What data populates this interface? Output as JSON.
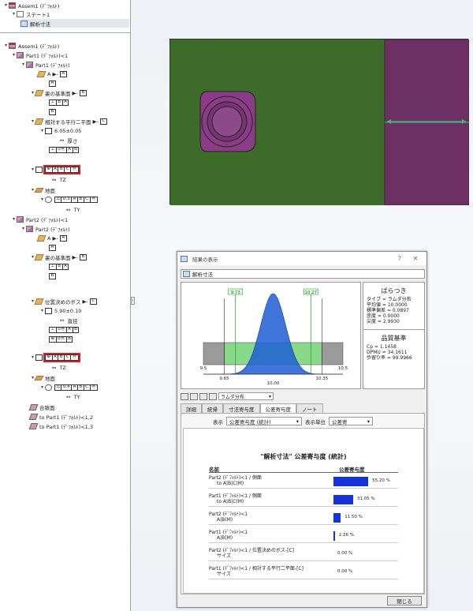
{
  "tree_top": {
    "root_label": "Assem1 (ﾃﾞﾌｫﾙﾄ)",
    "state_label": "ステート1",
    "study_label": "解析寸法"
  },
  "tree": {
    "root": "Assem1 (ﾃﾞﾌｫﾙﾄ)",
    "part1_instance": "Part1 (ﾃﾞﾌｫﾙﾄ)<1",
    "part1": "Part1 (ﾃﾞﾌｫﾙﾄ)",
    "datum_a": "A",
    "datum_a_box": "A",
    "back_datum": "裏の基準面",
    "back_datum_box": "B",
    "perp_frame": [
      "⊥",
      "B",
      "A"
    ],
    "b_box": "B",
    "pair_face": "相対する平行二平面",
    "pair_face_box": "C",
    "size_dim": "6.05±0.05",
    "thickness": "厚さ",
    "perp2_frame": [
      "⊥",
      "0Ⓜ",
      "A",
      "B"
    ],
    "pos_frame": [
      "⊕",
      "A",
      "B",
      "C",
      "Ⓜ"
    ],
    "tz": "TZ",
    "ground": "地面",
    "ground_frame": [
      "⌓",
      "0.3",
      "A",
      "B",
      "C",
      "Ⓜ"
    ],
    "ty": "TY",
    "part2_instance": "Part2 (ﾃﾞﾌｫﾙﾄ)<1",
    "part2": "Part2 (ﾃﾞﾌｫﾙﾄ)",
    "datum_a2": "A",
    "a2_box": "A",
    "back_datum2": "裏の基準面",
    "back_datum2_box": "B",
    "perp3_frame": [
      "⊥",
      "B",
      "A"
    ],
    "b2_box": "B",
    "boss": "位置決めのボス",
    "boss_box": "C",
    "dia_dim": "5.90±0.10",
    "dia_label": "直径",
    "perp4_frame": [
      "⊥",
      "0Ⓜ",
      "A",
      "B"
    ],
    "pos2_small": [
      "⊕",
      "0Ⓜ",
      "B"
    ],
    "pos2_frame": [
      "⊕",
      "A",
      "B",
      "C",
      "Ⓜ"
    ],
    "tz2": "TZ",
    "ground2": "地面",
    "ground2_frame": [
      "⌓",
      "0.4",
      "A",
      "B",
      "C",
      "Ⓜ"
    ],
    "ty2": "TY",
    "mate": "合致面",
    "to_part1_12": "to Part1 (ﾃﾞﾌｫﾙﾄ)<1,2",
    "to_part1_13": "to Part1 (ﾃﾞﾌｫﾙﾄ)<1,3"
  },
  "dialog": {
    "title": "結果の表示",
    "help": "?",
    "close_x": "✕",
    "name_field": "解析寸法",
    "toolbar_select": "ラムダ分布",
    "tabs": [
      "詳細",
      "統帰",
      "寸法寄与度",
      "公差寄与度",
      "ノート"
    ],
    "display_label": "表示",
    "display_value": "公差寄与度 (統計)",
    "unit_label": "表示単位",
    "unit_value": "公差寄",
    "close_button": "閉じる"
  },
  "stats": {
    "title": "ばらつき",
    "lines": [
      "タイプ = ラムダ分布",
      "平均値 = 10.0000",
      "標準偏差 = 0.0897",
      "歪度 = 0.0000",
      "尖度 = 2.9930"
    ],
    "quality_title": "品質基準",
    "quality_lines": [
      "Cp = 1.1458",
      "DPMU = 34.1611",
      "歩留り率 = 99.9966"
    ]
  },
  "chart_data": {
    "type": "area",
    "title": "",
    "xlabel": "",
    "ylabel": "",
    "xlim": [
      9.5,
      10.5
    ],
    "x_ticks": [
      9.5,
      9.65,
      10.0,
      10.35,
      10.5
    ],
    "x_tick_labels": [
      "9.5",
      "9.65",
      "10.00",
      "10.35",
      "10.5"
    ],
    "limit_labels": [
      "9.73",
      "10.27"
    ],
    "limits": [
      9.73,
      10.27
    ],
    "distribution": {
      "mean": 10.0,
      "std": 0.0897
    },
    "range_bands": [
      {
        "from": 9.5,
        "to": 9.65,
        "color": "#9b9b9b"
      },
      {
        "from": 9.65,
        "to": 10.35,
        "color": "#88d98a"
      },
      {
        "from": 10.35,
        "to": 10.5,
        "color": "#9b9b9b"
      }
    ],
    "colors": {
      "curve": "#1f5ed6",
      "limit_line": "#2c9e3c"
    }
  },
  "report": {
    "title": "\"解析寸法\" 公差寄与度 (統計)",
    "col_name": "名前",
    "col_value": "公差寄与度",
    "rows": [
      {
        "line1": "Part2 (ﾃﾞﾌｫﾙﾄ)<1 / 側面",
        "line2": "to A|B|C(M)",
        "value": 55.2,
        "label": "55.20 %"
      },
      {
        "line1": "Part1 (ﾃﾞﾌｫﾙﾄ)<1 / 側面",
        "line2": "to A|B|C(M)",
        "value": 31.05,
        "label": "31.05 %"
      },
      {
        "line1": "Part2 (ﾃﾞﾌｫﾙﾄ)<1",
        "line2": "A|B(M)",
        "value": 11.5,
        "label": "11.50 %"
      },
      {
        "line1": "Part1 (ﾃﾞﾌｫﾙﾄ)<1",
        "line2": "A|B(M)",
        "value": 2.26,
        "label": "2.26 %"
      },
      {
        "line1": "Part2 (ﾃﾞﾌｫﾙﾄ)<1 / 位置決めのボス-[C]",
        "line2": "サイズ",
        "value": 0,
        "label": "0.00 %"
      },
      {
        "line1": "Part1 (ﾃﾞﾌｫﾙﾄ)<1 / 相対する平行二平面-[C]",
        "line2": "サイズ",
        "value": 0,
        "label": "0.00 %"
      }
    ]
  },
  "colors": {
    "plate": "#3d6b2a",
    "bar": "#6e2f62",
    "boss": "#8a3d86",
    "arrow": "#39c659",
    "report_bar": "#1533d8",
    "highlight": "#e01b24"
  }
}
